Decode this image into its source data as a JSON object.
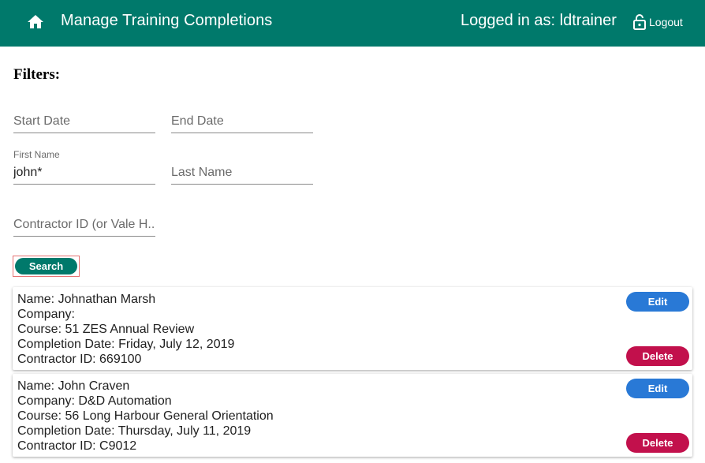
{
  "header": {
    "title": "Manage Training Completions",
    "logged_in": "Logged in as: ldtrainer",
    "logout_label": "Logout",
    "home_icon": "home-icon",
    "logout_icon": "lock-open-icon",
    "color": "#00796b"
  },
  "filters": {
    "title": "Filters:",
    "start_date": {
      "placeholder": "Start Date",
      "value": ""
    },
    "end_date": {
      "placeholder": "End Date",
      "value": ""
    },
    "first_name": {
      "label": "First Name",
      "value": "john*"
    },
    "last_name": {
      "placeholder": "Last Name",
      "value": ""
    },
    "contractor_id": {
      "placeholder": "Contractor ID (or Vale H...",
      "value": ""
    },
    "search_label": "Search"
  },
  "results": [
    {
      "name": "Name: Johnathan Marsh",
      "company": "Company:",
      "course": "Course: 51 ZES Annual Review",
      "completion_date": "Completion Date: Friday, July 12, 2019",
      "contractor_id": "Contractor ID: 669100",
      "edit_label": "Edit",
      "delete_label": "Delete"
    },
    {
      "name": "Name: John Craven",
      "company": "Company: D&D Automation",
      "course": "Course: 56 Long Harbour General Orientation",
      "completion_date": "Completion Date: Thursday, July 11, 2019",
      "contractor_id": "Contractor ID: C9012",
      "edit_label": "Edit",
      "delete_label": "Delete"
    }
  ],
  "colors": {
    "edit": "#2979d6",
    "delete": "#c2104c",
    "primary": "#00796b"
  }
}
